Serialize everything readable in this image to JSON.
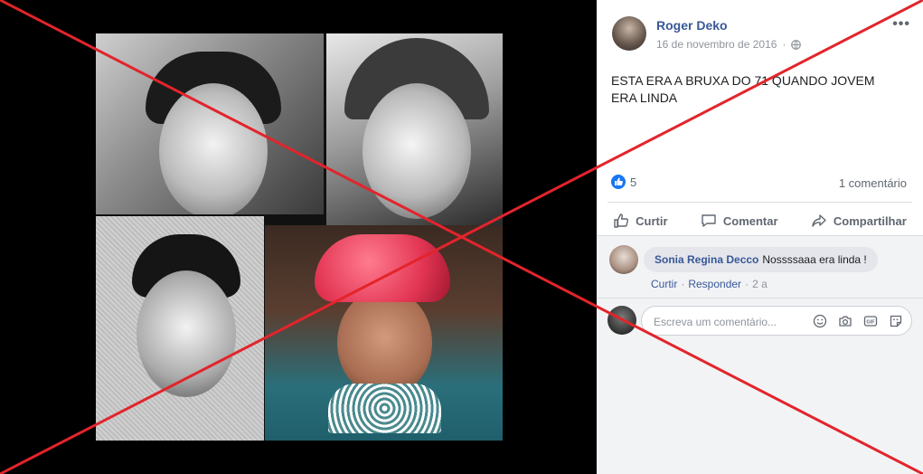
{
  "post": {
    "author": "Roger Deko",
    "date": "16 de novembro de 2016",
    "text_line1": "ESTA ERA A BRUXA DO 71 QUANDO JOVEM",
    "text_line2": "ERA LINDA",
    "like_count": "5",
    "comment_count": "1 comentário"
  },
  "actions": {
    "like": "Curtir",
    "comment": "Comentar",
    "share": "Compartilhar"
  },
  "comment": {
    "author": "Sonia Regina Decco",
    "text": "Nossssaaa era linda !",
    "like_link": "Curtir",
    "reply_link": "Responder",
    "time": "2 a"
  },
  "composer": {
    "placeholder": "Escreva um comentário..."
  },
  "icons": {
    "privacy": "globe-icon",
    "more": "more-options-icon",
    "composer_icons": [
      "emoji-icon",
      "camera-icon",
      "gif-icon",
      "sticker-icon"
    ]
  },
  "colors": {
    "link_blue": "#385898",
    "like_blue": "#1877f2",
    "cross_red": "#e3242b"
  }
}
